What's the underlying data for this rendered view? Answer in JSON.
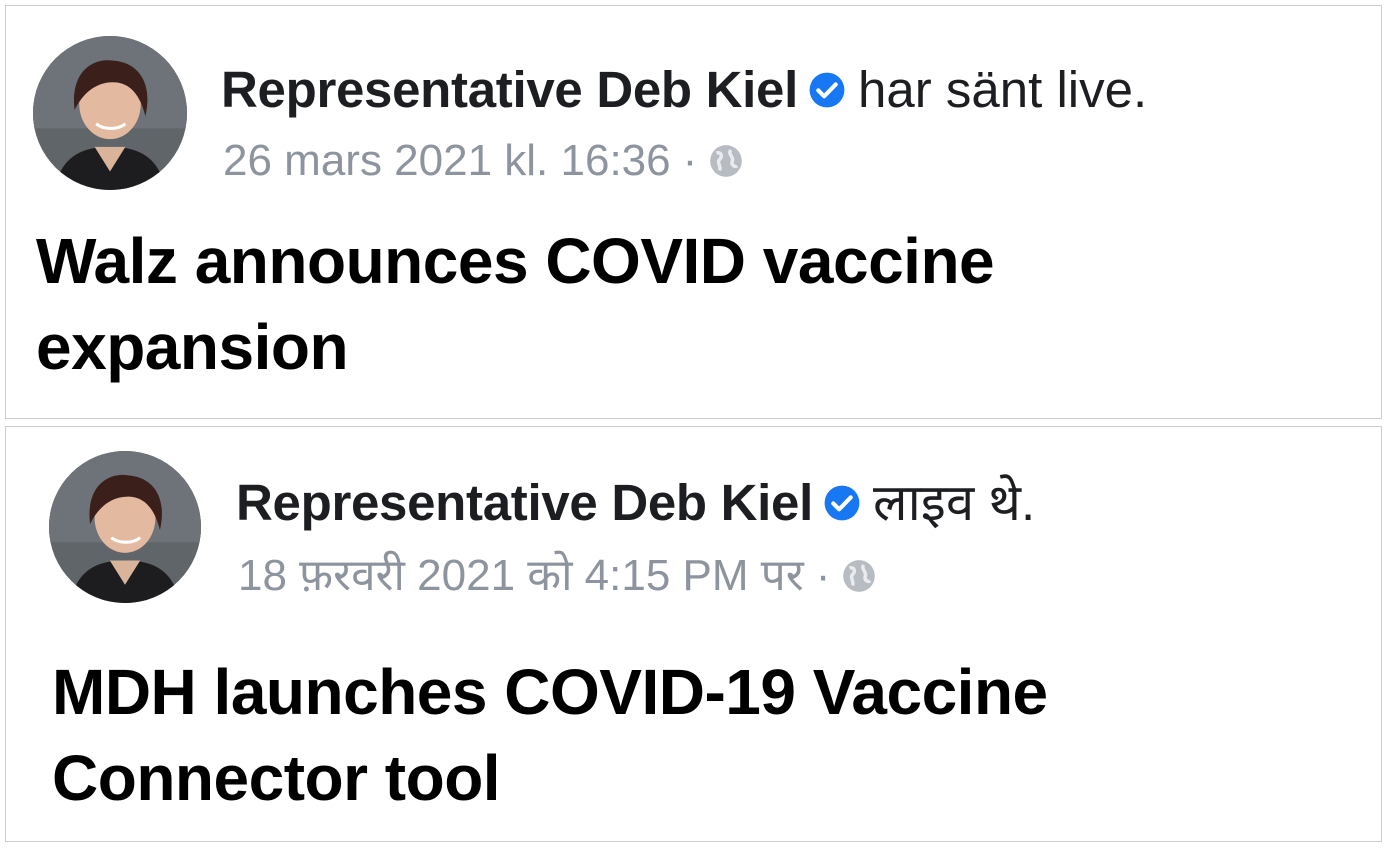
{
  "posts": [
    {
      "author": "Representative Deb Kiel",
      "action": "har sänt live.",
      "timestamp": "26 mars 2021 kl. 16:36",
      "separator": "·",
      "privacy_icon": "globe-icon",
      "verified_icon": "verified-badge-icon",
      "headline_line1": "Walz announces COVID vaccine",
      "headline_line2": "expansion"
    },
    {
      "author": "Representative Deb Kiel",
      "action": "लाइव थे.",
      "timestamp": "18 फ़रवरी 2021 को 4:15 PM पर",
      "separator": "·",
      "privacy_icon": "globe-icon",
      "verified_icon": "verified-badge-icon",
      "headline_line1": "MDH launches COVID-19 Vaccine",
      "headline_line2": "Connector tool"
    }
  ],
  "colors": {
    "verified_blue": "#1877f2",
    "meta_gray": "#8d949e",
    "border": "#c9ccd1"
  }
}
